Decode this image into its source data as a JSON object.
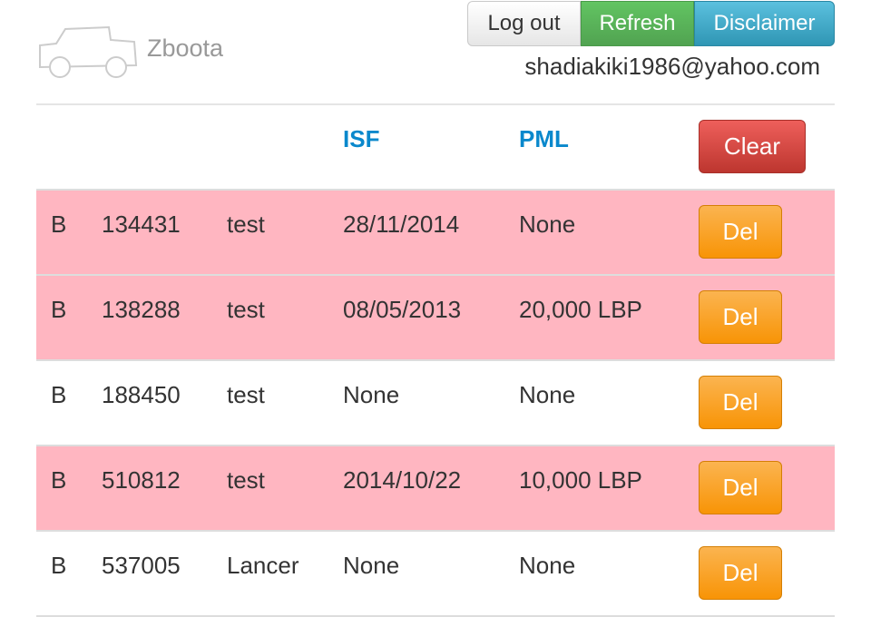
{
  "header": {
    "brand": "Zboota",
    "buttons": {
      "logout": "Log out",
      "refresh": "Refresh",
      "disclaimer": "Disclaimer"
    },
    "email": "shadiakiki1986@yahoo.com"
  },
  "table": {
    "headers": {
      "isf": "ISF",
      "pml": "PML"
    },
    "clear_label": "Clear",
    "delete_label": "Del",
    "highlight_color": "#ffb6c1",
    "rows": [
      {
        "type": "B",
        "number": "134431",
        "name": "test",
        "isf": "28/11/2014",
        "pml": "None",
        "highlight": true
      },
      {
        "type": "B",
        "number": "138288",
        "name": "test",
        "isf": "08/05/2013",
        "pml": "20,000 LBP",
        "highlight": true
      },
      {
        "type": "B",
        "number": "188450",
        "name": "test",
        "isf": "None",
        "pml": "None",
        "highlight": false
      },
      {
        "type": "B",
        "number": "510812",
        "name": "test",
        "isf": "2014/10/22",
        "pml": "10,000 LBP",
        "highlight": true
      },
      {
        "type": "B",
        "number": "537005",
        "name": "Lancer",
        "isf": "None",
        "pml": "None",
        "highlight": false
      }
    ]
  },
  "colors": {
    "header_accent": "#0a88cc",
    "refresh": "#5bb75b",
    "disclaimer": "#49afcd",
    "clear": "#da4f49",
    "delete": "#faa732"
  }
}
